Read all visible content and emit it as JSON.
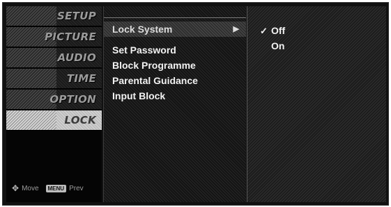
{
  "tabs": [
    {
      "label": "SETUP",
      "active": false
    },
    {
      "label": "PICTURE",
      "active": false
    },
    {
      "label": "AUDIO",
      "active": false
    },
    {
      "label": "TIME",
      "active": false
    },
    {
      "label": "OPTION",
      "active": false
    },
    {
      "label": "LOCK",
      "active": true
    }
  ],
  "footer": {
    "move_icon": "✥",
    "move_label": "Move",
    "menu_key": "MENU",
    "prev_label": "Prev"
  },
  "submenu": {
    "items": [
      {
        "label": "Lock System",
        "selected": true
      },
      {
        "label": "Set Password"
      },
      {
        "label": "Block Programme"
      },
      {
        "label": "Parental Guidance"
      },
      {
        "label": "Input Block"
      }
    ],
    "arrow": "▶"
  },
  "options": {
    "items": [
      {
        "label": "Off",
        "check": "✓",
        "checked": true
      },
      {
        "label": "On",
        "check": "",
        "checked": false
      }
    ]
  }
}
